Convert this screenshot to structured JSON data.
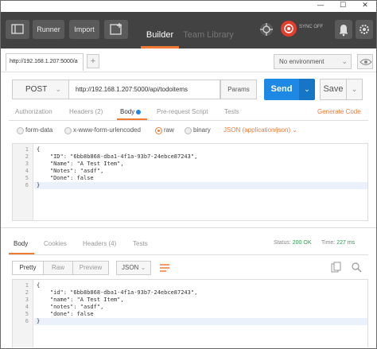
{
  "window": {
    "minimize_glyph": "—",
    "maximize_glyph": "☐",
    "close_glyph": "✕"
  },
  "toolbar": {
    "runner_label": "Runner",
    "import_label": "Import",
    "tabs": [
      "Builder",
      "Team Library"
    ],
    "sync_label": "SYNC OFF",
    "icons": [
      "sidebar-toggle-icon",
      "new-tab-icon",
      "interceptor-icon",
      "sync-icon",
      "notifications-icon",
      "settings-icon"
    ]
  },
  "envbar": {
    "request_tab_label": "http://192.168.1.207:5000/a",
    "add_tab_glyph": "+",
    "environment": "No environment"
  },
  "request": {
    "method": "POST",
    "url": "http://192.168.1.207:5000/api/todoitems",
    "params_label": "Params",
    "send_label": "Send",
    "save_label": "Save",
    "tabs": [
      "Authorization",
      "Headers (2)",
      "Body",
      "Pre-request Script",
      "Tests"
    ],
    "generate_code_label": "Generate Code",
    "body_modes": [
      "form-data",
      "x-www-form-urlencoded",
      "raw",
      "binary"
    ],
    "selected_mode": "raw",
    "content_type": "JSON (application/json)",
    "body_lines": [
      "{",
      "    \"ID\": \"6bb8b868-dba1-4f1a-93b7-24ebce87243\",",
      "    \"Name\": \"A Test Item\",",
      "    \"Notes\": \"asdf\",",
      "    \"Done\": false",
      "}"
    ]
  },
  "response": {
    "tabs": [
      "Body",
      "Cookies",
      "Headers (4)",
      "Tests"
    ],
    "status_label": "Status:",
    "status_value": "200 OK",
    "time_label": "Time:",
    "time_value": "227 ms",
    "view_modes": [
      "Pretty",
      "Raw",
      "Preview"
    ],
    "format": "JSON",
    "body_lines": [
      "{",
      "    \"id\": \"6bb8b868-dba1-4f1a-93b7-24ebce87243\",",
      "    \"name\": \"A Test Item\",",
      "    \"notes\": \"asdf\",",
      "    \"done\": false",
      "}"
    ]
  },
  "colors": {
    "accent": "#f37a35",
    "send": "#1e88e5",
    "toolbar": "#424242",
    "status_ok": "#2a9d4a"
  }
}
